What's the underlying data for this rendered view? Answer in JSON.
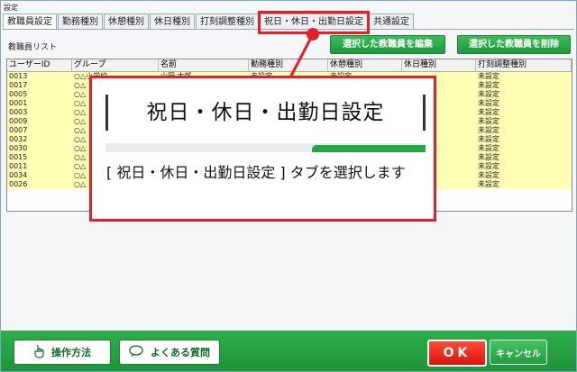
{
  "window": {
    "title": "設定"
  },
  "tabs": [
    "教職員設定",
    "勤務種別",
    "休憩種別",
    "休日種別",
    "打刻調整種別",
    "祝日・休日・出勤日設定",
    "共通設定"
  ],
  "list_label": "教職員リスト",
  "actions": {
    "edit": "選択した教職員を編集",
    "delete": "選択した教職員を削除"
  },
  "table": {
    "columns": [
      "ユーザーID",
      "グループ",
      "名前",
      "勤務種別",
      "休憩種別",
      "休日種別",
      "打刻調整種別"
    ],
    "rows": [
      [
        "0013",
        "○△小学校",
        "山田 太郎",
        "未設定",
        "未設定",
        "",
        "未設定"
      ],
      [
        "0017",
        "○△",
        "",
        "",
        "",
        "",
        "未設定"
      ],
      [
        "0005",
        "○△",
        "",
        "",
        "",
        "",
        "未設定"
      ],
      [
        "0001",
        "○△",
        "",
        "",
        "",
        "",
        "未設定"
      ],
      [
        "0003",
        "○△",
        "",
        "",
        "",
        "",
        "未設定"
      ],
      [
        "0009",
        "○△",
        "",
        "",
        "",
        "",
        "未設定"
      ],
      [
        "0007",
        "○△",
        "",
        "",
        "",
        "",
        "未設定"
      ],
      [
        "0032",
        "○△",
        "",
        "",
        "",
        "",
        "未設定"
      ],
      [
        "0030",
        "○△",
        "",
        "",
        "",
        "",
        "未設定"
      ],
      [
        "0015",
        "○△",
        "",
        "",
        "",
        "",
        "未設定"
      ],
      [
        "0011",
        "○△",
        "",
        "",
        "",
        "",
        "未設定"
      ],
      [
        "0034",
        "○△",
        "",
        "",
        "",
        "",
        "未設定"
      ],
      [
        "0026",
        "○△",
        "",
        "",
        "",
        "",
        "未設定"
      ]
    ]
  },
  "footer": {
    "help": "操作方法",
    "faq": "よくある質問",
    "ok": "OK",
    "cancel": "キャンセル"
  },
  "callout": {
    "zoom_label": "祝日・休日・出勤日設定",
    "instruction": "[ 祝日・休日・出勤日設定 ] タブを選択します"
  },
  "colors": {
    "accent_red": "#e3202a",
    "green": "#25a745",
    "row_yellow": "#fffeb4"
  }
}
